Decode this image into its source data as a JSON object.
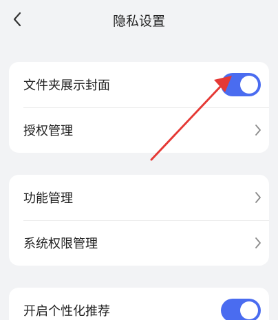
{
  "header": {
    "title": "隐私设置",
    "back_icon": "chevron-left-icon"
  },
  "sections": {
    "card1": {
      "folder_cover": {
        "label": "文件夹展示封面",
        "toggle_on": true
      },
      "auth_manage": {
        "label": "授权管理",
        "icon": "chevron-right-icon"
      }
    },
    "card2": {
      "feature_manage": {
        "label": "功能管理",
        "icon": "chevron-right-icon"
      },
      "system_permission": {
        "label": "系统权限管理",
        "icon": "chevron-right-icon"
      }
    },
    "card3": {
      "personalized": {
        "label": "开启个性化推荐",
        "toggle_on": true
      }
    }
  },
  "colors": {
    "background": "#f2f3f5",
    "card": "#ffffff",
    "toggle_on": "#4a6cf0",
    "annotation_arrow": "#e53935",
    "text": "#222222",
    "chevron": "#8a8a8a"
  }
}
